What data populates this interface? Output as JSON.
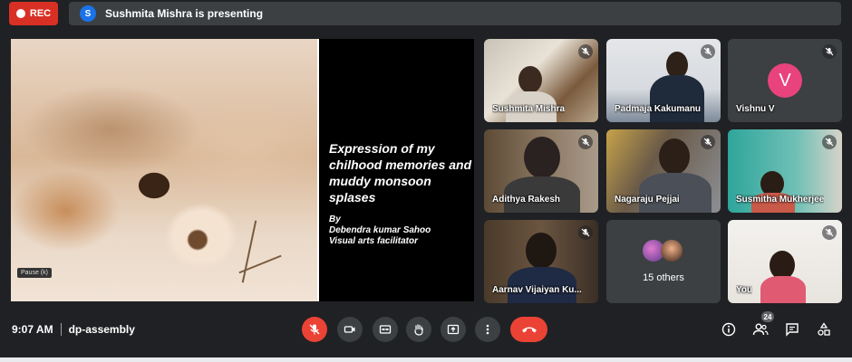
{
  "recording": {
    "label": "REC"
  },
  "presenter": {
    "initial": "S",
    "text": "Sushmita Mishra is presenting"
  },
  "presentation": {
    "title": "Expression of my chilhood memories and muddy monsoon splases",
    "by": "By",
    "author": "Debendra kumar Sahoo",
    "role": "Visual arts facilitator",
    "pause_hint": "Pause (k)"
  },
  "participants": [
    {
      "name": "Sushmita Mishra"
    },
    {
      "name": "Padmaja Kakumanu"
    },
    {
      "name": "Vishnu V",
      "initial": "V",
      "avatar_color": "#e8437c"
    },
    {
      "name": "Adithya Rakesh"
    },
    {
      "name": "Nagaraju Pejjai"
    },
    {
      "name": "Susmitha Mukherjee"
    },
    {
      "name": "Aarnav Vijaiyan Ku..."
    },
    {
      "name": "15 others"
    },
    {
      "name": "You"
    }
  ],
  "meeting": {
    "time": "9:07 AM",
    "code": "dp-assembly",
    "people_count": "24"
  },
  "icons": {
    "mic_off": "mic-off-icon",
    "camera": "camera-icon",
    "captions": "captions-icon",
    "raise_hand": "hand-icon",
    "present": "present-icon",
    "more": "more-vert-icon",
    "hangup": "call-end-icon",
    "info": "info-icon",
    "people": "people-icon",
    "chat": "chat-icon",
    "activities": "activities-icon"
  },
  "colors": {
    "rec": "#d93025",
    "danger": "#ea4335",
    "surface": "#3c4043",
    "background": "#202124",
    "presenter_av": "#1a73e8"
  }
}
